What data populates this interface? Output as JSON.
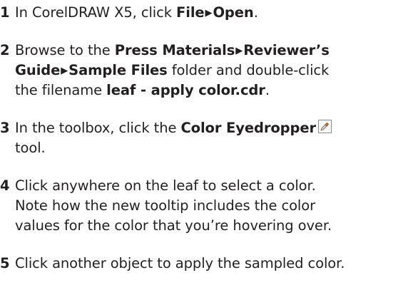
{
  "steps": [
    {
      "number": "1",
      "lines": [
        [
          {
            "t": "In CorelDRAW X5, click "
          },
          {
            "t": "File",
            "b": true
          },
          {
            "t": "▶",
            "arrow": true
          },
          {
            "t": "Open",
            "b": true
          },
          {
            "t": "."
          }
        ]
      ]
    },
    {
      "number": "2",
      "lines": [
        [
          {
            "t": "Browse to the "
          },
          {
            "t": "Press Materials",
            "b": true
          },
          {
            "t": "▶",
            "arrow": true
          },
          {
            "t": "Reviewer’s",
            "b": true
          }
        ],
        [
          {
            "t": "Guide",
            "b": true
          },
          {
            "t": "▶",
            "arrow": true
          },
          {
            "t": "Sample Files",
            "b": true
          },
          {
            "t": " folder and double-click"
          }
        ],
        [
          {
            "t": "the filename "
          },
          {
            "t": "leaf - apply color.cdr",
            "b": true
          },
          {
            "t": "."
          }
        ]
      ]
    },
    {
      "number": "3",
      "lines": [
        [
          {
            "t": "In the toolbox, click the "
          },
          {
            "t": "Color Eyedropper",
            "b": true
          },
          {
            "icon": "eyedropper-icon"
          }
        ],
        [
          {
            "t": "tool."
          }
        ]
      ]
    },
    {
      "number": "4",
      "lines": [
        [
          {
            "t": "Click anywhere on the leaf to select a color."
          }
        ],
        [
          {
            "t": "Note how the new tooltip includes the color"
          }
        ],
        [
          {
            "t": "values for the color that you’re hovering over."
          }
        ]
      ]
    },
    {
      "number": "5",
      "lines": [
        [
          {
            "t": "Click another object to apply the sampled color."
          }
        ]
      ]
    }
  ]
}
